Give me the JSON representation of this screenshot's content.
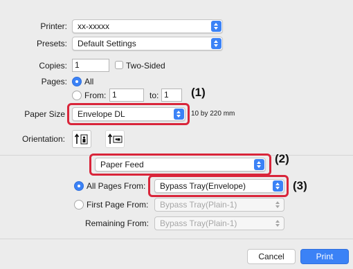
{
  "printer": {
    "label": "Printer:",
    "value": "xx-xxxxx"
  },
  "presets": {
    "label": "Presets:",
    "value": "Default Settings"
  },
  "copies": {
    "label": "Copies:",
    "value": "1",
    "two_sided_label": "Two-Sided"
  },
  "pages": {
    "label": "Pages:",
    "all_label": "All",
    "from_label": "From:",
    "from_value": "1",
    "to_label": "to:",
    "to_value": "1"
  },
  "paper_size": {
    "label": "Paper Size",
    "value": "Envelope DL",
    "dimensions": "10 by 220 mm"
  },
  "orientation": {
    "label": "Orientation:"
  },
  "panel": {
    "value": "Paper Feed"
  },
  "paper_feed": {
    "all_pages_label": "All Pages From:",
    "all_pages_value": "Bypass Tray(Envelope)",
    "first_page_label": "First Page From:",
    "first_page_value": "Bypass Tray(Plain-1)",
    "remaining_label": "Remaining From:",
    "remaining_value": "Bypass Tray(Plain-1)"
  },
  "callouts": {
    "one": "(1)",
    "two": "(2)",
    "three": "(3)"
  },
  "buttons": {
    "cancel": "Cancel",
    "print": "Print"
  },
  "colors": {
    "accent": "#3b82f6",
    "highlight": "#d9253a"
  }
}
